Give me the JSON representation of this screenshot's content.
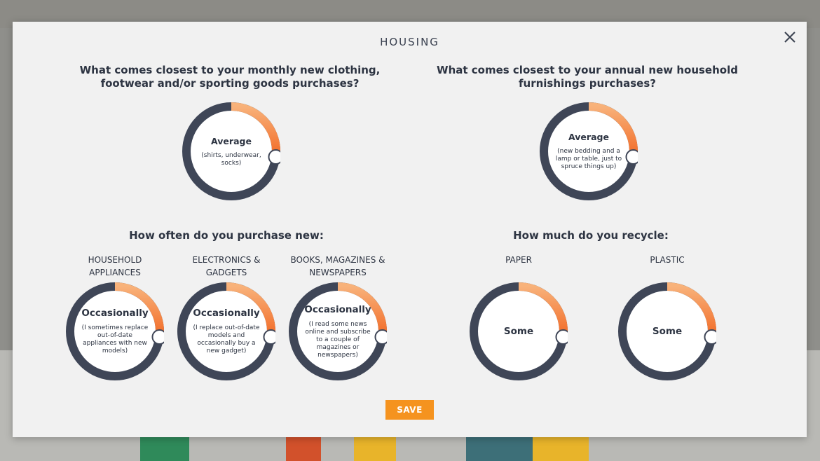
{
  "modal": {
    "title": "HOUSING",
    "close_label": "×"
  },
  "questions": {
    "clothing": "What comes closest to your monthly new clothing, footwear and/or sporting goods purchases?",
    "furnishings": "What comes closest to your annual new household furnishings purchases?"
  },
  "dials_top": [
    {
      "value": "Average",
      "desc": "(shirts, underwear, socks)",
      "level": 0.27
    },
    {
      "value": "Average",
      "desc": "(new bedding and a lamp or table, just to spruce things up)",
      "level": 0.27
    }
  ],
  "section_headers": {
    "purchase": "How often do you purchase new:",
    "recycle": "How much do you recycle:"
  },
  "purchase_categories": [
    {
      "label": "HOUSEHOLD APPLIANCES",
      "value": "Occasionally",
      "desc": "(I sometimes replace out-of-date appliances with new models)",
      "level": 0.27
    },
    {
      "label": "ELECTRONICS & GADGETS",
      "value": "Occasionally",
      "desc": "(I replace out-of-date models and occasionally buy a new gadget)",
      "level": 0.27
    },
    {
      "label": "BOOKS, MAGAZINES & NEWSPAPERS",
      "value": "Occasionally",
      "desc": "(I read some news online and subscribe to a couple of magazines or newspapers)",
      "level": 0.27
    }
  ],
  "recycle_categories": [
    {
      "label": "PAPER",
      "value": "Some",
      "level": 0.27
    },
    {
      "label": "PLASTIC",
      "value": "Some",
      "level": 0.27
    }
  ],
  "save_label": "SAVE",
  "colors": {
    "accent": "#f5931f",
    "dial_track": "#3f4657",
    "text": "#2d3442"
  }
}
